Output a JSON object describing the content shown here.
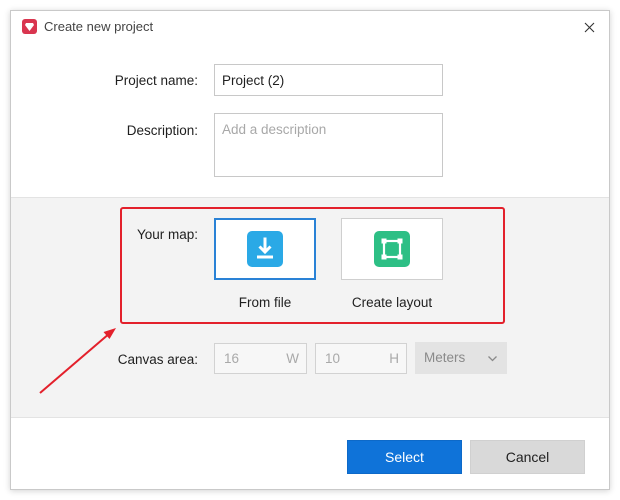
{
  "window": {
    "title": "Create new project"
  },
  "form": {
    "project_name_label": "Project name:",
    "project_name_value": "Project (2)",
    "description_label": "Description:",
    "description_placeholder": "Add a description",
    "your_map_label": "Your map:",
    "map_options": [
      {
        "label": "From file",
        "icon": "download-icon",
        "selected": true,
        "color": "#2aa9e6"
      },
      {
        "label": "Create layout",
        "icon": "layout-frame-icon",
        "selected": false,
        "color": "#2dbf85"
      }
    ],
    "canvas_area_label": "Canvas area:",
    "canvas_width_value": "16",
    "canvas_width_unit": "W",
    "canvas_height_value": "10",
    "canvas_height_unit": "H",
    "units_selected": "Meters"
  },
  "footer": {
    "select_label": "Select",
    "cancel_label": "Cancel"
  },
  "colors": {
    "accent": "#0f73d9",
    "highlight": "#e3202b",
    "selected_border": "#2a82d6"
  }
}
